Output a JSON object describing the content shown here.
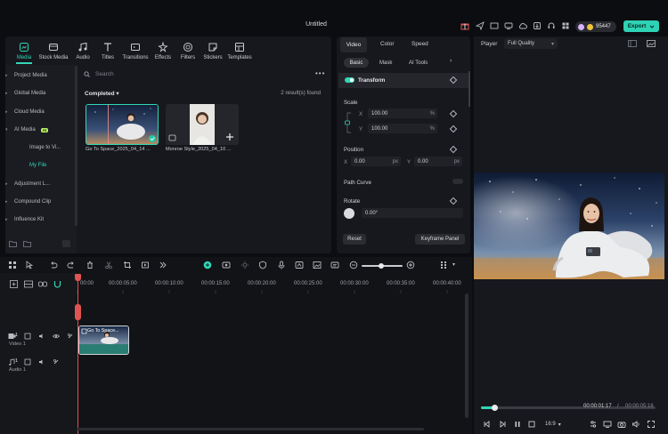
{
  "app": {
    "title": "Untitled",
    "credits": "95447",
    "export_label": "Export"
  },
  "media": {
    "tabs": [
      {
        "label": "Media",
        "icon": "media-icon",
        "active": true
      },
      {
        "label": "Stock Media",
        "icon": "stock-media-icon"
      },
      {
        "label": "Audio",
        "icon": "audio-icon"
      },
      {
        "label": "Titles",
        "icon": "titles-icon"
      },
      {
        "label": "Transitions",
        "icon": "transitions-icon"
      },
      {
        "label": "Effects",
        "icon": "effects-icon"
      },
      {
        "label": "Filters",
        "icon": "filters-icon"
      },
      {
        "label": "Stickers",
        "icon": "stickers-icon"
      },
      {
        "label": "Templates",
        "icon": "templates-icon"
      }
    ],
    "sidebar": [
      {
        "label": "Project Media"
      },
      {
        "label": "Global Media"
      },
      {
        "label": "Cloud Media"
      },
      {
        "label": "AI Media",
        "badge": "AI"
      },
      {
        "label": "Image to Vi...",
        "sub": true
      },
      {
        "label": "My File",
        "sub": true,
        "active": true
      },
      {
        "label": "Adjustment L..."
      },
      {
        "label": "Compound Clip"
      },
      {
        "label": "Influence Kit"
      }
    ],
    "search_placeholder": "Search",
    "filter_label": "Completed",
    "result_count": "2 result(s) found",
    "items": [
      {
        "label": "Go To Space_2025_04_14 ..."
      },
      {
        "label": "Monroe Style_2025_04_10 ..."
      }
    ]
  },
  "properties": {
    "tabs": [
      "Video",
      "Color",
      "Speed"
    ],
    "subtabs": [
      "Basic",
      "Mask",
      "AI Tools"
    ],
    "section": "Transform",
    "scale": {
      "label": "Scale",
      "x_label": "X",
      "x": "100.00",
      "y_label": "Y",
      "y": "100.00",
      "unit": "%"
    },
    "position": {
      "label": "Position",
      "x_label": "X",
      "x": "0.00",
      "y_label": "Y",
      "y": "0.00",
      "unit": "px"
    },
    "path_curve": "Path Curve",
    "rotate": {
      "label": "Rotate",
      "value": "0.00°"
    },
    "reset_label": "Reset",
    "keyframe_label": "Keyframe Panel"
  },
  "player": {
    "label": "Player",
    "quality": "Full Quality",
    "time_current": "00:00:01:17",
    "time_separator": "/",
    "time_total": "00:00:05:16",
    "progress": 0.08,
    "ratio": "16:9"
  },
  "timeline": {
    "ticks": [
      "00:00",
      "00:00:05:00",
      "00:00:10:00",
      "00:00:15:00",
      "00:00:20:00",
      "00:00:25:00",
      "00:00:30:00",
      "00:00:35:00",
      "00:00:40:00"
    ],
    "tracks": [
      {
        "number": "1",
        "name": "Video 1"
      },
      {
        "number": "1",
        "name": "Audio 1"
      }
    ],
    "clip_label": "Go To Space..."
  },
  "colors": {
    "accent": "#32d6b6",
    "playhead": "#e05353",
    "background": "#17181d"
  }
}
